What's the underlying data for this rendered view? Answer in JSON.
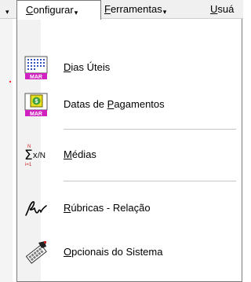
{
  "menubar": {
    "leading_caret": "▾",
    "configurar": {
      "pre": "",
      "hotkey": "C",
      "rest": "onfigurar"
    },
    "ferramentas": {
      "pre": "",
      "hotkey": "F",
      "rest": "erramentas"
    },
    "usuarios_partial": {
      "pre": "",
      "hotkey": "U",
      "rest": "suá"
    },
    "caret": "▾"
  },
  "menu": {
    "items": [
      {
        "pre": "",
        "hotkey": "D",
        "rest": "ias Úteis",
        "icon": "calendar-mar-icon",
        "icon_text": "MAR"
      },
      {
        "pre": "Datas de ",
        "hotkey": "P",
        "rest": "agamentos",
        "icon": "calendar-payment-icon",
        "icon_text": "MAR"
      },
      {
        "pre": "",
        "hotkey": "M",
        "rest": "édias",
        "icon": "summation-icon",
        "icon_top": "N",
        "icon_bottom": "i=1",
        "icon_div": "/N"
      },
      {
        "pre": "",
        "hotkey": "R",
        "rest": "úbricas - Relação",
        "icon": "signature-icon"
      },
      {
        "pre": "",
        "hotkey": "O",
        "rest": "pcionais do Sistema",
        "icon": "system-options-icon"
      }
    ]
  },
  "colors": {
    "menu_bg": "#ffffff",
    "menu_border": "#7a7a7a",
    "menubar_bg": "#f0f0f0",
    "calendar_label": "#d020c0"
  }
}
